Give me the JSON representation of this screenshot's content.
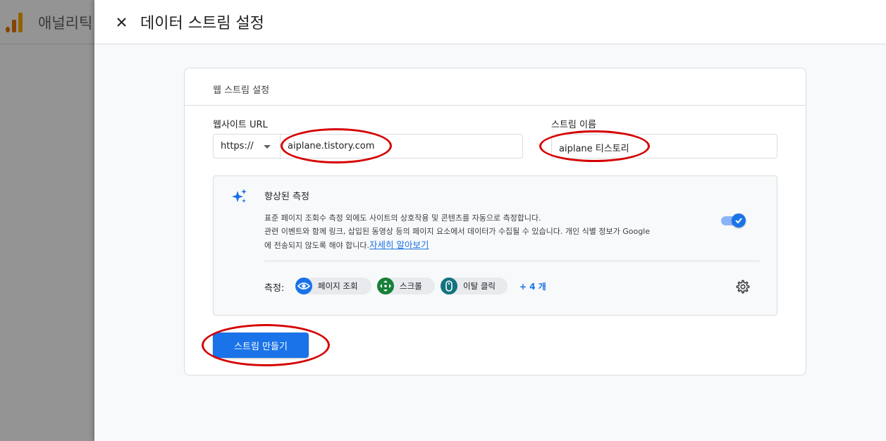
{
  "app": {
    "title": "애널리틱"
  },
  "drawer": {
    "title": "데이터 스트림 설정"
  },
  "card": {
    "title": "웹 스트림 설정"
  },
  "url": {
    "label": "웹사이트 URL",
    "protocol": "https://",
    "value": "aiplane.tistory.com"
  },
  "stream_name": {
    "label": "스트림 이름",
    "value": "aiplane 티스토리"
  },
  "enhanced": {
    "title": "향상된 측정",
    "desc_line1": "표준 페이지 조회수 측정 외에도 사이트의 상호작용 및 콘텐츠를 자동으로 측정합니다.",
    "desc_line2": "관련 이벤트와 함께 링크, 삽입된 동영상 등의 페이지 요소에서 데이터가 수집될 수 있습니다. 개인 식별 정보가 Google",
    "desc_line3": "에 전송되지 않도록 해야 합니다.",
    "learn_more": "자세히 알아보기",
    "toggle_on": true,
    "metrics_label": "측정:",
    "chips": [
      "페이지 조회",
      "스크롤",
      "이탈 클릭"
    ],
    "more": "+ 4 개"
  },
  "create_button": "스트림 만들기",
  "colors": {
    "accent": "#1a73e8",
    "annotation": "#d50000",
    "chip_page": "#1a73e8",
    "chip_scroll": "#188038",
    "chip_click": "#12737e"
  },
  "icons": [
    "close-icon",
    "sparkle-icon",
    "check-icon",
    "eye-icon",
    "scroll-icon",
    "mouse-icon",
    "gear-icon",
    "chevron-down-icon"
  ]
}
